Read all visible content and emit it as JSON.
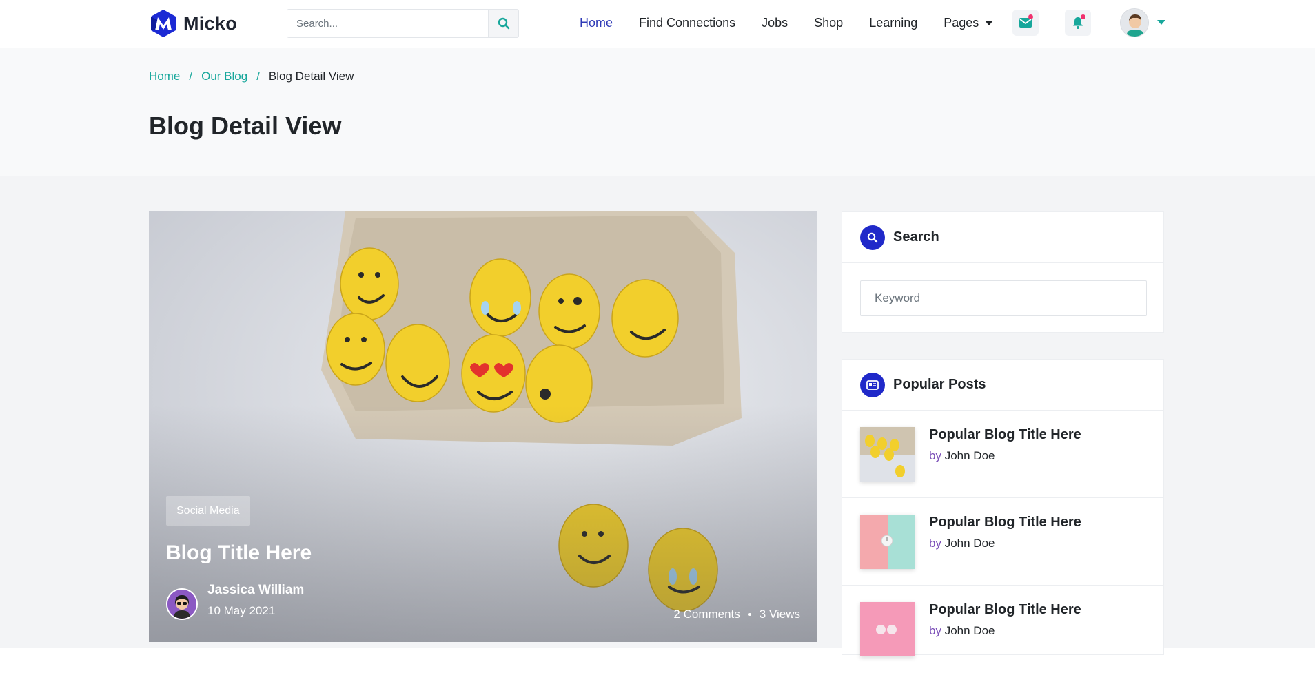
{
  "header": {
    "brand": "Micko",
    "search_placeholder": "Search...",
    "nav": [
      "Home",
      "Find Connections",
      "Jobs",
      "Shop",
      "Learning",
      "Pages"
    ]
  },
  "breadcrumb": {
    "items": [
      "Home",
      "Our Blog",
      "Blog Detail View"
    ],
    "separator": "/"
  },
  "page_title": "Blog Detail View",
  "post": {
    "category": "Social Media",
    "title": "Blog Title Here",
    "author": "Jassica William",
    "date": "10 May 2021",
    "comments": "2 Comments",
    "views": "3 Views"
  },
  "sidebar": {
    "search": {
      "title": "Search",
      "placeholder": "Keyword"
    },
    "popular": {
      "title": "Popular Posts",
      "posts": [
        {
          "title": "Popular Blog Title Here",
          "by": "by",
          "author": "John Doe"
        },
        {
          "title": "Popular Blog Title Here",
          "by": "by",
          "author": "John Doe"
        },
        {
          "title": "Popular Blog Title Here",
          "by": "by",
          "author": "John Doe"
        }
      ]
    }
  },
  "colors": {
    "accent": "#17a79b",
    "nav_active": "#2f3bb7",
    "widget_icon_bg": "#2029c9",
    "notification_dot": "#f0326e"
  }
}
